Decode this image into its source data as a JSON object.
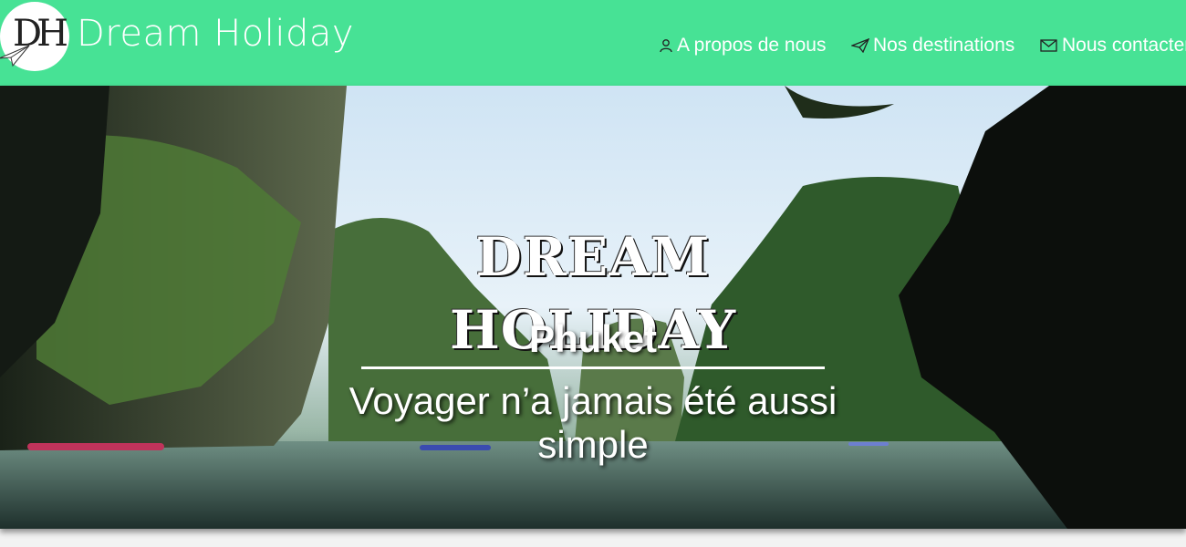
{
  "header": {
    "logo_monogram": "DH",
    "brand": "Dream Holiday",
    "bg_color": "#47e295"
  },
  "nav": [
    {
      "label": "A propos de nous",
      "icon": "user-icon"
    },
    {
      "label": "Nos destinations",
      "icon": "paper-plane-icon"
    },
    {
      "label": "Nous contacter",
      "icon": "envelope-icon"
    }
  ],
  "hero": {
    "title": "DREAM HOLIDAY",
    "city": "Phuket",
    "tagline": "Voyager n’a jamais été aussi simple",
    "image": "phuket-bay-photo"
  }
}
